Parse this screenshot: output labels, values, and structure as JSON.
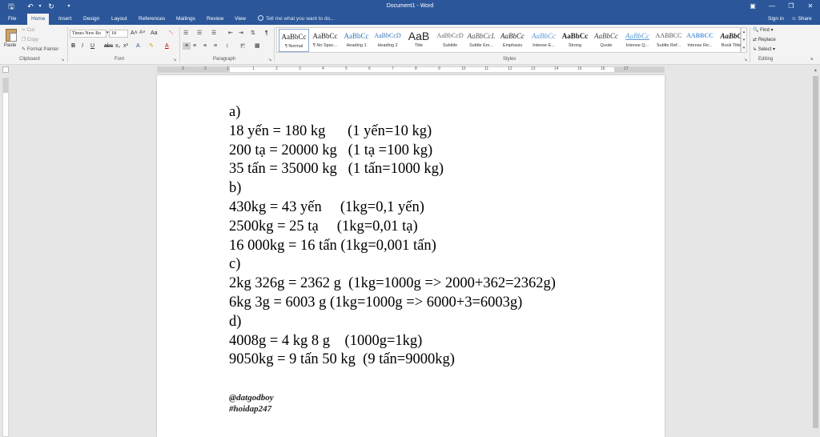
{
  "window": {
    "title": "Document1 - Word"
  },
  "tabs": [
    "File",
    "Home",
    "Insert",
    "Design",
    "Layout",
    "References",
    "Mailings",
    "Review",
    "View"
  ],
  "tell_me": "Tell me what you want to do...",
  "account": {
    "sign_in": "Sign in",
    "share": "Share"
  },
  "clipboard": {
    "paste": "Paste",
    "cut": "Cut",
    "copy": "Copy",
    "format_painter": "Format Painter",
    "label": "Clipboard"
  },
  "font": {
    "name": "Times New Ro",
    "size": "18",
    "label": "Font"
  },
  "paragraph": {
    "label": "Paragraph"
  },
  "styles": {
    "label": "Styles",
    "items": [
      {
        "sample": "AaBbCc",
        "name": "¶ Normal"
      },
      {
        "sample": "AaBbCc",
        "name": "¶ No Spac..."
      },
      {
        "sample": "AaBbCc",
        "name": "Heading 1"
      },
      {
        "sample": "AaBbCcD",
        "name": "Heading 2"
      },
      {
        "sample": "AaB",
        "name": "Title"
      },
      {
        "sample": "AaBbCcD",
        "name": "Subtitle"
      },
      {
        "sample": "AaBbCcL",
        "name": "Subtle Em..."
      },
      {
        "sample": "AaBbCc",
        "name": "Emphasis"
      },
      {
        "sample": "AaBbCc",
        "name": "Intense E..."
      },
      {
        "sample": "AaBbCc",
        "name": "Strong"
      },
      {
        "sample": "AaBbCc",
        "name": "Quote"
      },
      {
        "sample": "AaBbCc",
        "name": "Intense Q..."
      },
      {
        "sample": "AABBCC",
        "name": "Subtle Ref..."
      },
      {
        "sample": "AABBCC",
        "name": "Intense Re..."
      },
      {
        "sample": "AaBbC",
        "name": "Book Title"
      }
    ]
  },
  "editing": {
    "find": "Find",
    "replace": "Replace",
    "select": "Select",
    "label": "Editing"
  },
  "document": {
    "lines": [
      "a)",
      "18 yến = 180 kg      (1 yến=10 kg)",
      "200 tạ = 20000 kg   (1 tạ =100 kg)",
      "35 tấn = 35000 kg   (1 tấn=1000 kg)",
      "b)",
      "430kg = 43 yến     (1kg=0,1 yến)",
      "2500kg = 25 tạ     (1kg=0,01 tạ)",
      "16 000kg = 16 tấn (1kg=0,001 tấn)",
      "c)",
      "2kg 326g = 2362 g  (1kg=1000g => 2000+362=2362g)",
      "6kg 3g = 6003 g (1kg=1000g => 6000+3=6003g)",
      "d)",
      "4008g = 4 kg 8 g    (1000g=1kg)",
      "9050kg = 9 tấn 50 kg  (9 tấn=9000kg)"
    ],
    "signature": [
      "@datgodboy",
      "#hoidap247"
    ]
  },
  "ruler_numbers": [
    "3",
    "2",
    "1",
    "1",
    "2",
    "3",
    "4",
    "5",
    "6",
    "7",
    "8",
    "9",
    "10",
    "11",
    "12",
    "13",
    "14",
    "15",
    "16",
    "17"
  ],
  "colors": {
    "accent": "#2b579a",
    "ribbon": "#f3f3f3",
    "canvas": "#e6e6e6"
  }
}
